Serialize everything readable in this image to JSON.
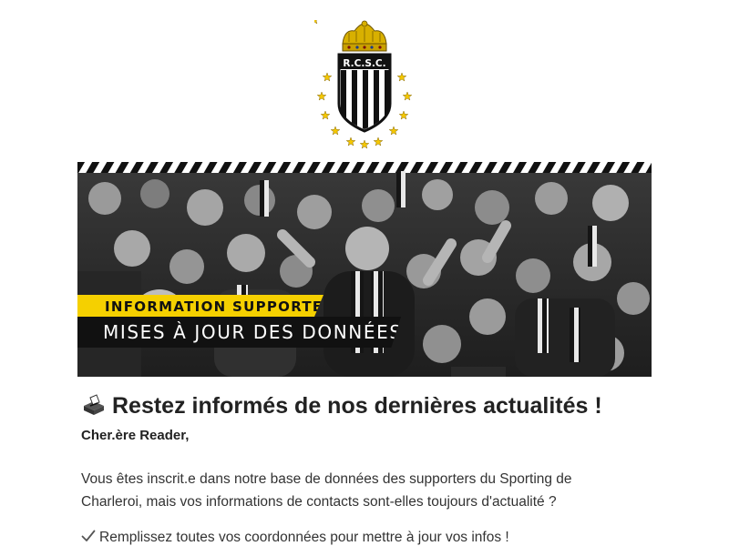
{
  "logo": {
    "text": "R.C.S.C.",
    "star_color": "#f5c800",
    "crown_color": "#d4a800"
  },
  "banner": {
    "tag_line_1": "INFORMATION SUPPORTERS",
    "tag_line_2": "MISES À JOUR DES DONNÉES",
    "tag_yellow": "#f5d000",
    "tag_black": "#111111"
  },
  "email": {
    "headline_icon": "ballot-box-icon",
    "headline": "Restez informés de nos dernières actualités !",
    "greeting": "Cher.ère Reader,",
    "paragraph_1": "Vous êtes inscrit.e dans notre base de données des supporters du Sporting de Charleroi, mais vos informations de contacts sont-elles toujours d'actualité ?",
    "paragraph_2_icon": "check-mark-icon",
    "paragraph_2": "Remplissez toutes vos coordonnées pour mettre à jour vos infos !"
  }
}
